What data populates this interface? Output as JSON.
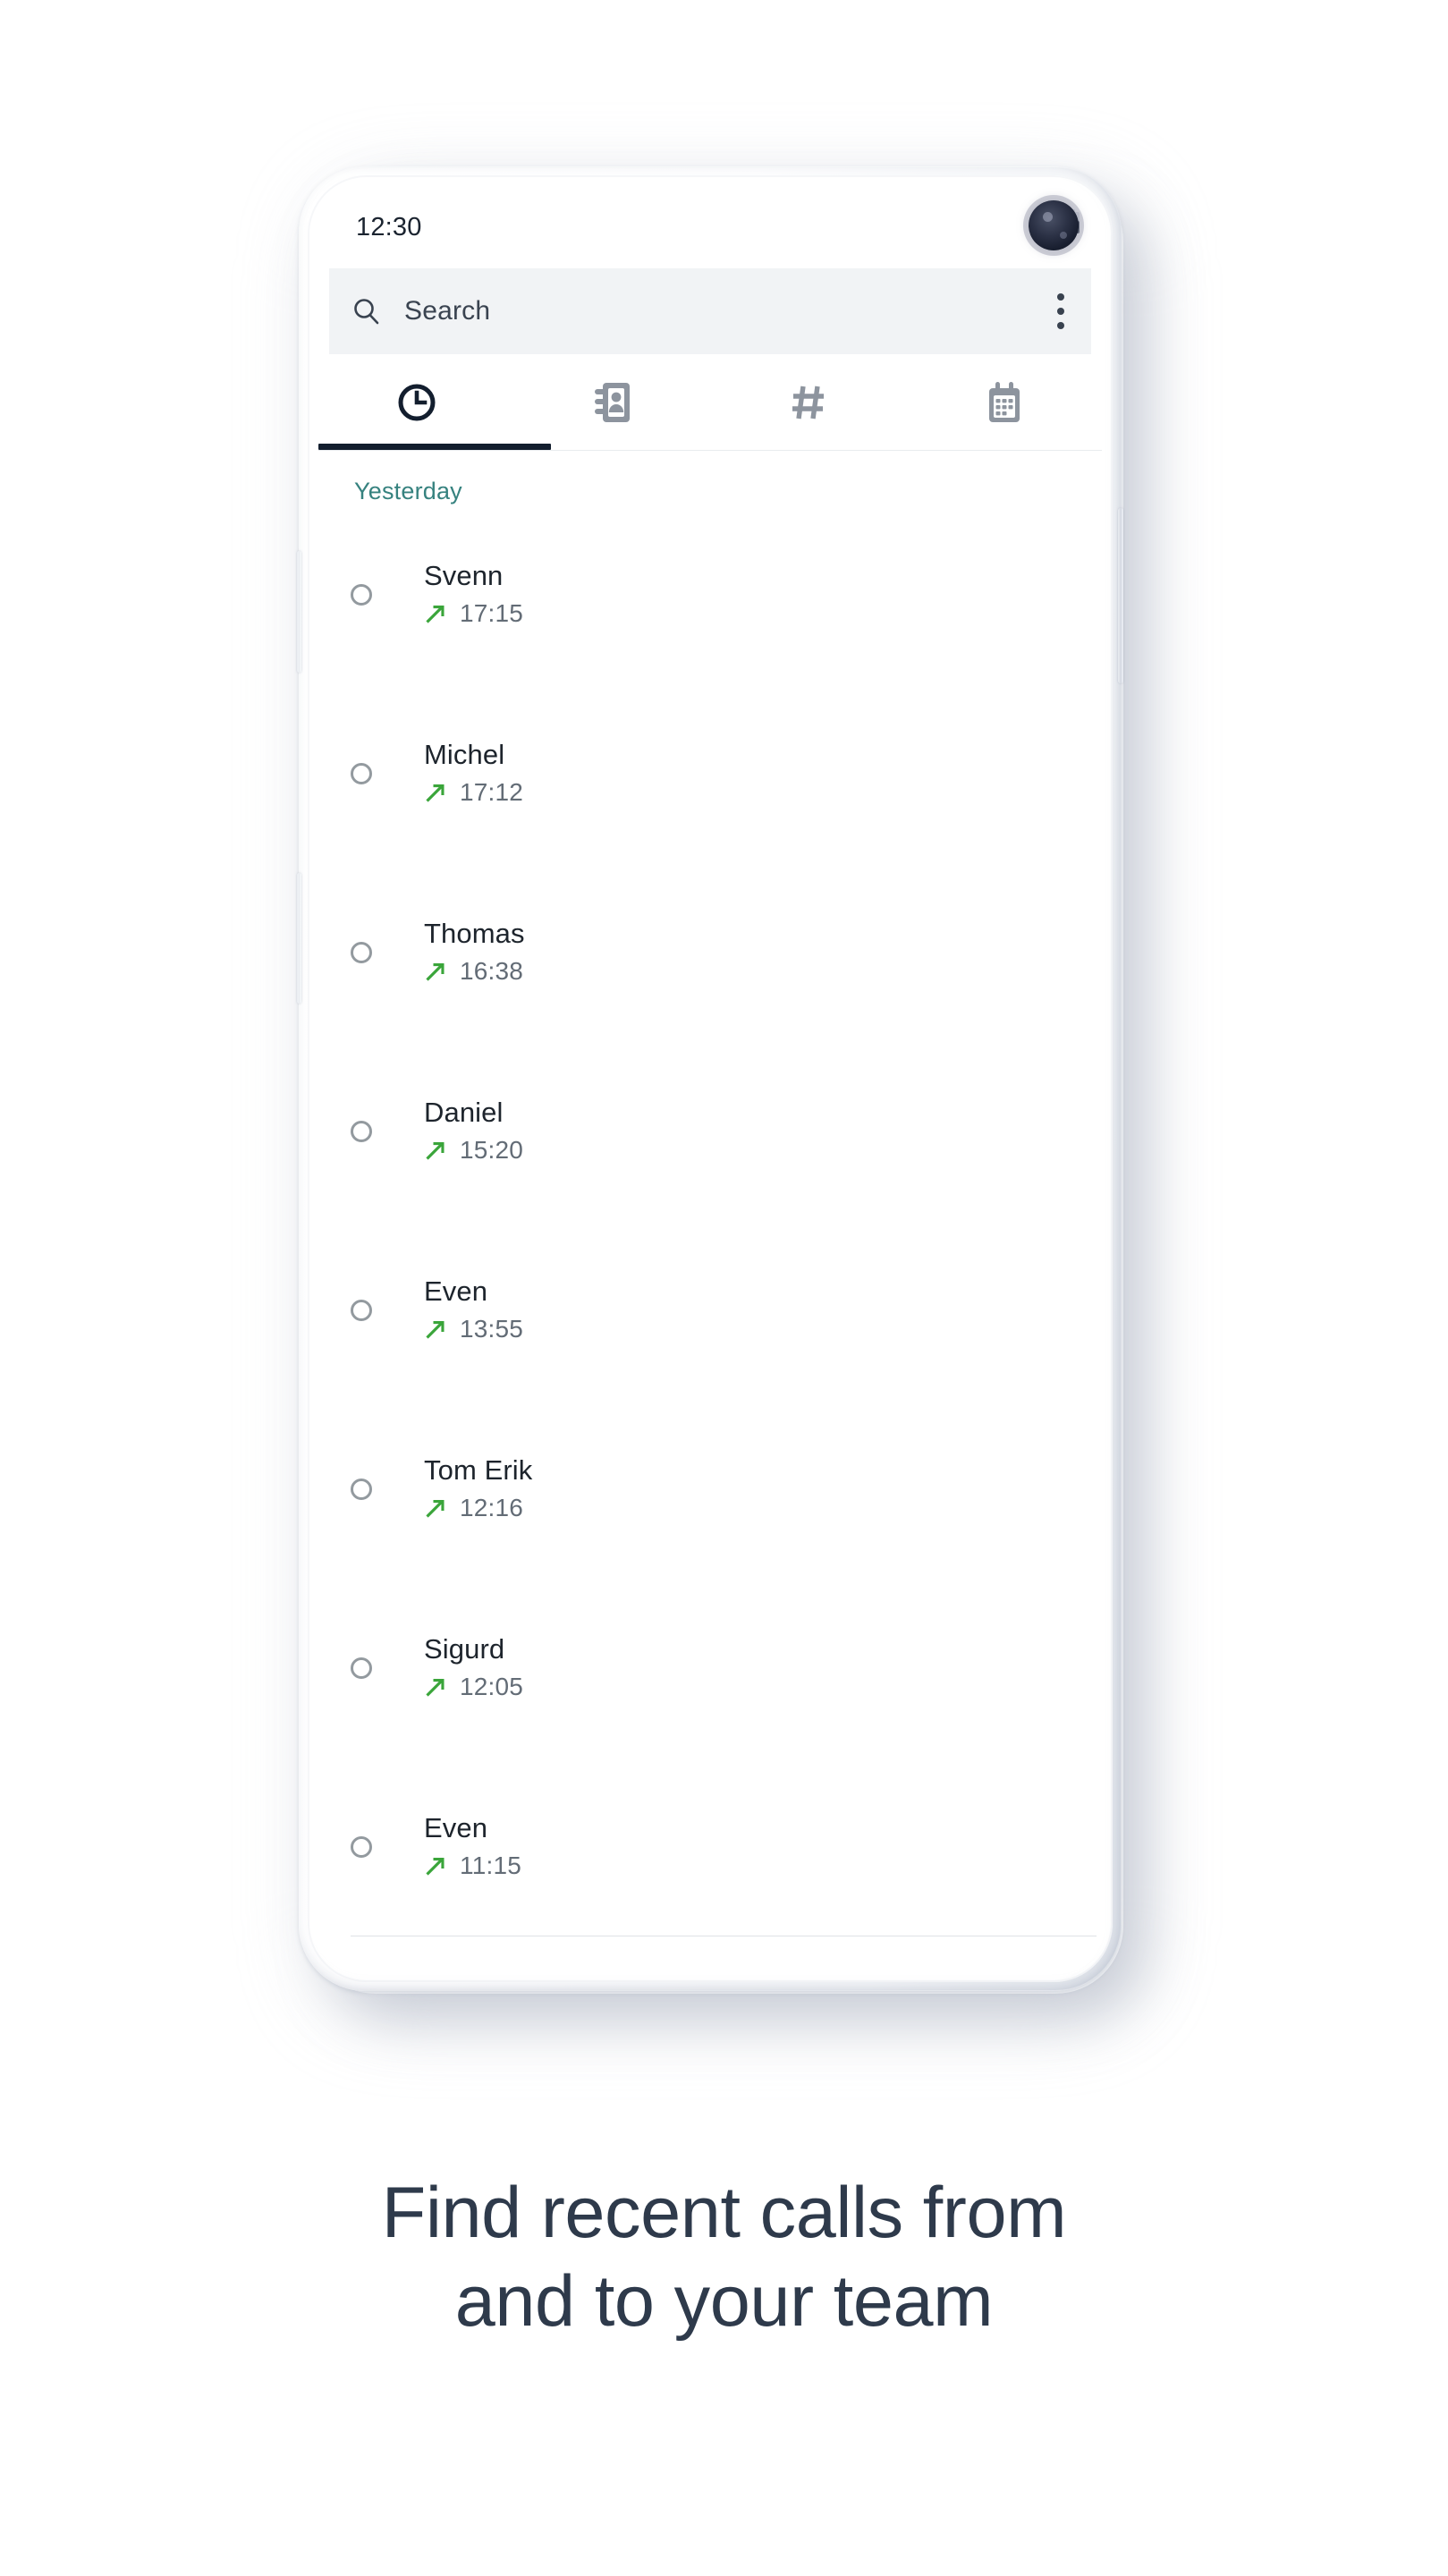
{
  "device": {
    "status_bar": {
      "time": "12:30",
      "signal_icon": "signal-bars-icon",
      "battery_icon": "battery-half-icon",
      "camera_icon": "front-camera-punch-hole"
    }
  },
  "search": {
    "icon": "search-icon",
    "placeholder": "Search",
    "value": "",
    "overflow_icon": "more-vertical-icon"
  },
  "tabs": [
    {
      "id": "recents",
      "icon": "clock-icon",
      "label": "Recents",
      "active": true
    },
    {
      "id": "contacts",
      "icon": "address-book-icon",
      "label": "Contacts",
      "active": false
    },
    {
      "id": "keypad",
      "icon": "hash-icon",
      "label": "Keypad",
      "active": false
    },
    {
      "id": "calendar",
      "icon": "calendar-icon",
      "label": "Calendar",
      "active": false
    }
  ],
  "call_list": {
    "day_header": "Yesterday",
    "rows": [
      {
        "name": "Svenn",
        "time": "17:15",
        "direction": "outgoing",
        "direction_icon": "arrow-up-right-icon",
        "avatar": "avatar-placeholder"
      },
      {
        "name": "Michel",
        "time": "17:12",
        "direction": "outgoing",
        "direction_icon": "arrow-up-right-icon",
        "avatar": "avatar-placeholder"
      },
      {
        "name": "Thomas",
        "time": "16:38",
        "direction": "outgoing",
        "direction_icon": "arrow-up-right-icon",
        "avatar": "avatar-placeholder"
      },
      {
        "name": "Daniel",
        "time": "15:20",
        "direction": "outgoing",
        "direction_icon": "arrow-up-right-icon",
        "avatar": "avatar-placeholder"
      },
      {
        "name": "Even",
        "time": "13:55",
        "direction": "outgoing",
        "direction_icon": "arrow-up-right-icon",
        "avatar": "avatar-placeholder"
      },
      {
        "name": "Tom Erik",
        "time": "12:16",
        "direction": "outgoing",
        "direction_icon": "arrow-up-right-icon",
        "avatar": "avatar-placeholder"
      },
      {
        "name": "Sigurd",
        "time": "12:05",
        "direction": "outgoing",
        "direction_icon": "arrow-up-right-icon",
        "avatar": "avatar-placeholder"
      },
      {
        "name": "Even",
        "time": "11:15",
        "direction": "outgoing",
        "direction_icon": "arrow-up-right-icon",
        "avatar": "avatar-placeholder"
      }
    ]
  },
  "caption": {
    "line1": "Find recent calls from",
    "line2": "and to your team"
  },
  "colors": {
    "page_background": "#ffffff",
    "day_header_teal": "#36827f",
    "outgoing_green": "#3aa53a",
    "active_tab_dark": "#131e2e",
    "inactive_tab_grey": "#8d949e",
    "name_text": "#1d242c",
    "time_text": "#636c76",
    "search_field_bg": "#f1f3f5",
    "caption_text": "#2e3a4b"
  }
}
